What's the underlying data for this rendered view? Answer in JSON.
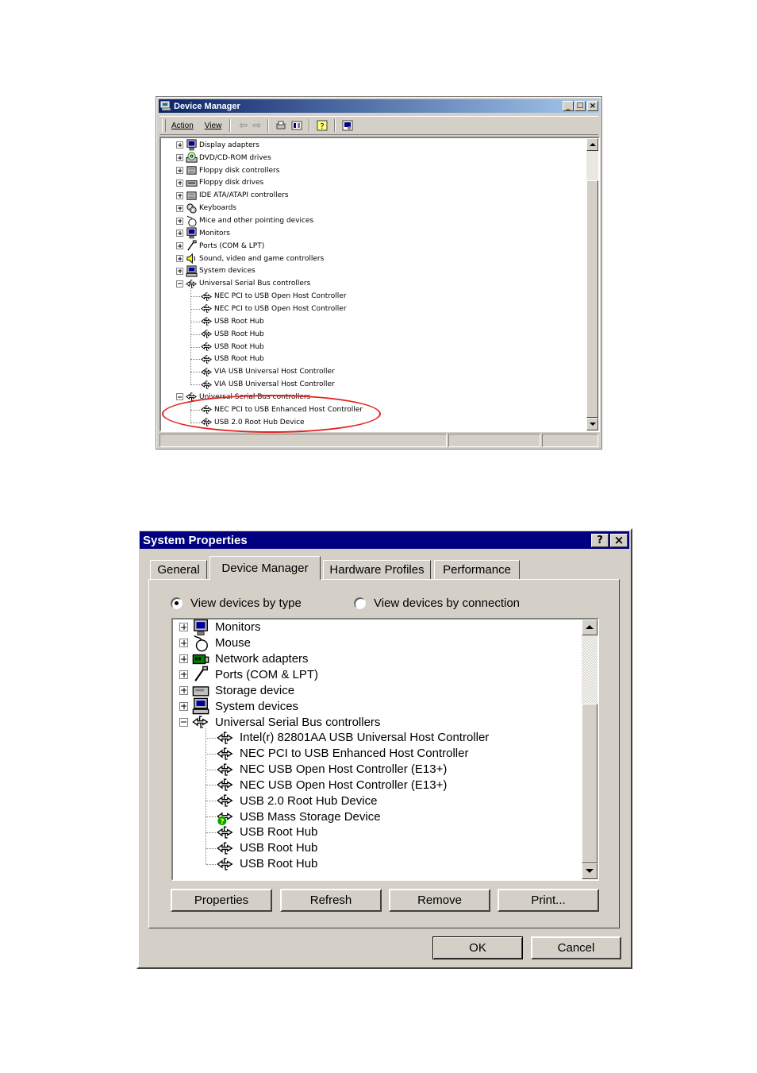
{
  "device_manager": {
    "title": "Device Manager",
    "menu": {
      "action": "Action",
      "view": "View"
    },
    "title_buttons": {
      "minimize": "_",
      "maximize": "□",
      "close": "×"
    },
    "tree": [
      {
        "label": "Display adapters",
        "icon": "display-adapter-icon"
      },
      {
        "label": "DVD/CD-ROM drives",
        "icon": "cdrom-icon"
      },
      {
        "label": "Floppy disk controllers",
        "icon": "controller-icon"
      },
      {
        "label": "Floppy disk drives",
        "icon": "floppy-icon"
      },
      {
        "label": "IDE ATA/ATAPI controllers",
        "icon": "controller-icon"
      },
      {
        "label": "Keyboards",
        "icon": "keyboard-icon"
      },
      {
        "label": "Mice and other pointing devices",
        "icon": "mouse-icon"
      },
      {
        "label": "Monitors",
        "icon": "monitor-icon"
      },
      {
        "label": "Ports (COM & LPT)",
        "icon": "port-icon"
      },
      {
        "label": "Sound, video and game controllers",
        "icon": "sound-icon"
      },
      {
        "label": "System devices",
        "icon": "computer-icon"
      },
      {
        "label": "Universal Serial Bus controllers",
        "icon": "usb-icon",
        "expanded": true
      },
      {
        "label": "NEC PCI to USB Open Host Controller",
        "icon": "usb-icon",
        "child": true
      },
      {
        "label": "NEC PCI to USB Open Host Controller",
        "icon": "usb-icon",
        "child": true
      },
      {
        "label": "USB Root Hub",
        "icon": "usb-icon",
        "child": true
      },
      {
        "label": "USB Root Hub",
        "icon": "usb-icon",
        "child": true
      },
      {
        "label": "USB Root Hub",
        "icon": "usb-icon",
        "child": true
      },
      {
        "label": "USB Root Hub",
        "icon": "usb-icon",
        "child": true
      },
      {
        "label": "VIA USB Universal Host Controller",
        "icon": "usb-icon",
        "child": true
      },
      {
        "label": "VIA USB Universal Host Controller",
        "icon": "usb-icon",
        "child": true
      },
      {
        "label": "Universal Serial Bus controllers",
        "icon": "usb-icon",
        "expanded": true
      },
      {
        "label": "NEC PCI to USB Enhanced Host Controller",
        "icon": "usb-icon",
        "child": true
      },
      {
        "label": "USB 2.0 Root Hub Device",
        "icon": "usb-icon",
        "child": true
      }
    ]
  },
  "system_properties": {
    "title": "System Properties",
    "title_buttons": {
      "help": "?",
      "close": "×"
    },
    "tabs": [
      "General",
      "Device Manager",
      "Hardware Profiles",
      "Performance"
    ],
    "active_tab": "Device Manager",
    "radio_by_type": "View devices by type",
    "radio_by_connection": "View devices by connection",
    "tree": [
      {
        "label": "Monitors",
        "icon": "monitor-icon"
      },
      {
        "label": "Mouse",
        "icon": "mouse-icon"
      },
      {
        "label": "Network adapters",
        "icon": "network-adapter-icon"
      },
      {
        "label": "Ports (COM & LPT)",
        "icon": "port-icon"
      },
      {
        "label": "Storage device",
        "icon": "storage-icon"
      },
      {
        "label": "System devices",
        "icon": "computer-icon"
      },
      {
        "label": "Universal Serial Bus controllers",
        "icon": "usb-icon",
        "expanded": true
      },
      {
        "label": "Intel(r) 82801AA USB Universal Host Controller",
        "icon": "usb-icon",
        "child": true
      },
      {
        "label": "NEC PCI to USB Enhanced Host Controller",
        "icon": "usb-icon",
        "child": true
      },
      {
        "label": "NEC USB Open Host Controller (E13+)",
        "icon": "usb-icon",
        "child": true
      },
      {
        "label": "NEC USB Open Host Controller (E13+)",
        "icon": "usb-icon",
        "child": true
      },
      {
        "label": "USB 2.0 Root Hub Device",
        "icon": "usb-icon",
        "child": true
      },
      {
        "label": "USB Mass Storage Device",
        "icon": "usb-warning-icon",
        "child": true
      },
      {
        "label": "USB Root Hub",
        "icon": "usb-icon",
        "child": true
      },
      {
        "label": "USB Root Hub",
        "icon": "usb-icon",
        "child": true
      },
      {
        "label": "USB Root Hub",
        "icon": "usb-icon",
        "child": true
      }
    ],
    "buttons": {
      "properties": "Properties",
      "refresh": "Refresh",
      "remove": "Remove",
      "print": "Print..."
    },
    "ok": "OK",
    "cancel": "Cancel"
  },
  "colors": {
    "title_bar": "#0a246a",
    "title_bar_end": "#a6caf0",
    "highlight_ellipse": "#e3231f",
    "face": "#d4d0c8"
  }
}
